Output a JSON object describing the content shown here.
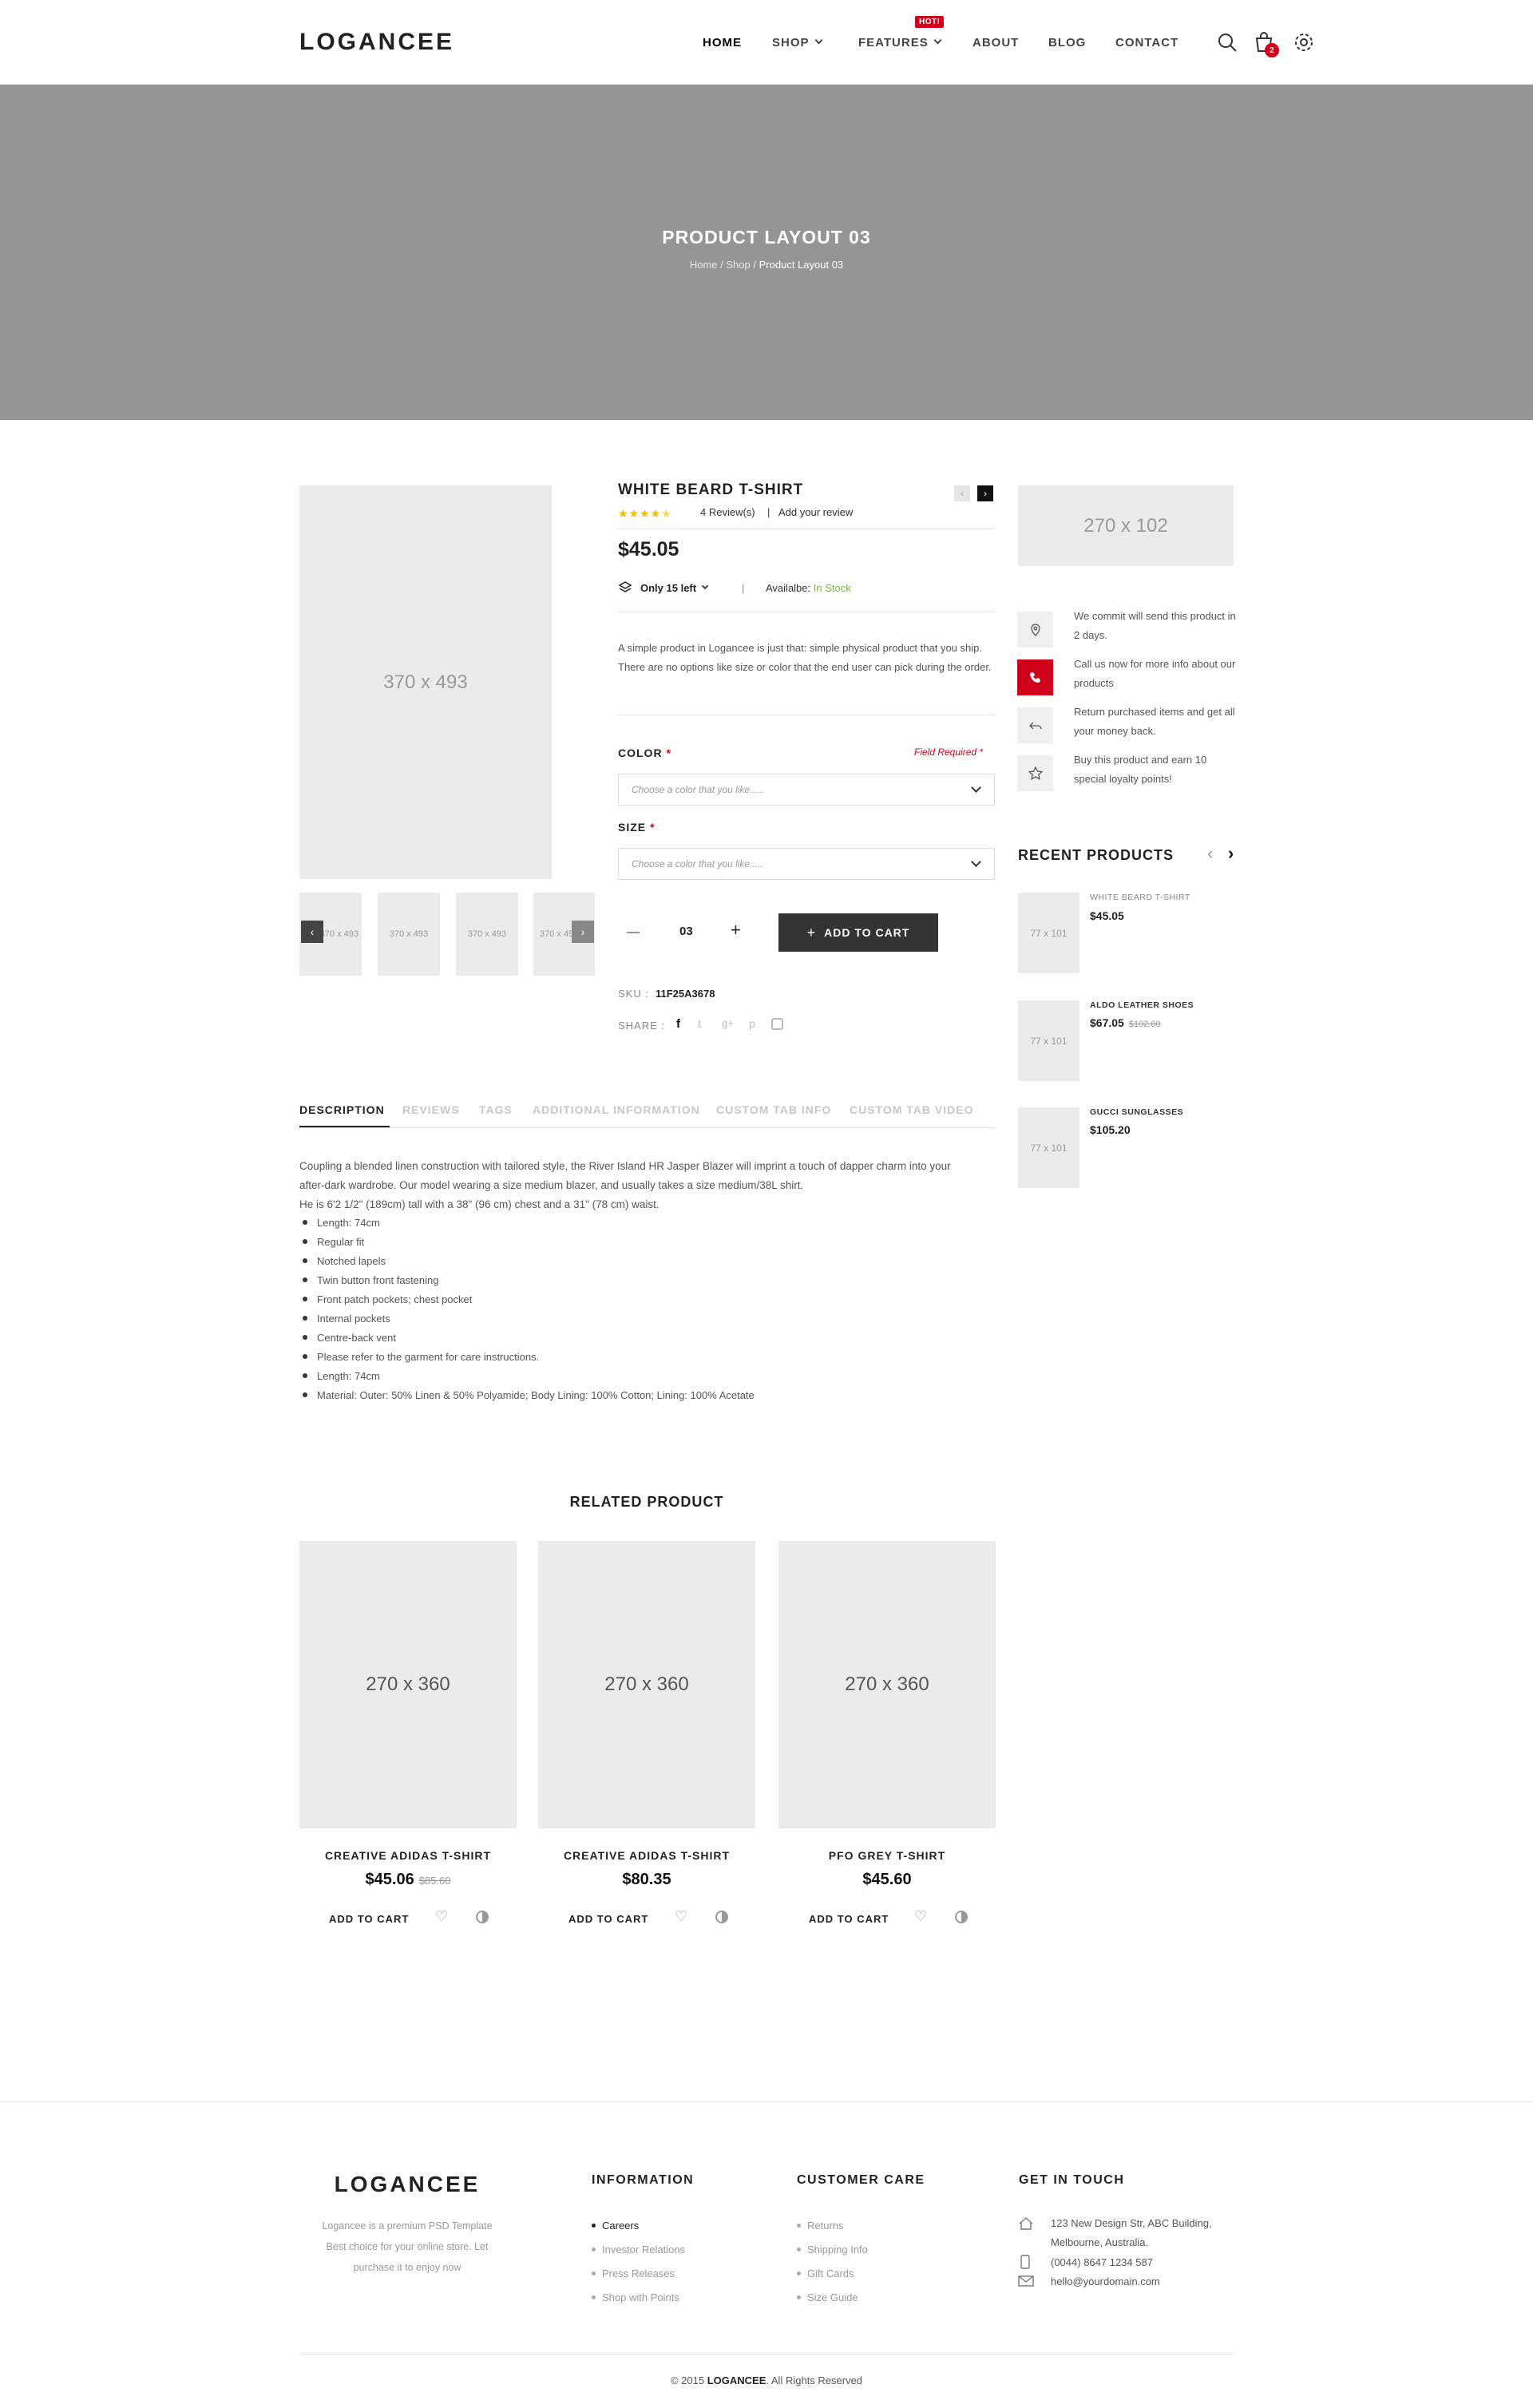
{
  "header": {
    "logo": "LOGANCEE",
    "nav": [
      "HOME",
      "SHOP",
      "FEATURES",
      "ABOUT",
      "BLOG",
      "CONTACT"
    ],
    "hot_badge": "HOT!",
    "cart_count": "2"
  },
  "banner": {
    "title": "PRODUCT LAYOUT 03",
    "crumb_home": "Home",
    "crumb_shop": "Shop",
    "crumb_current": "Product Layout 03",
    "sep": "/"
  },
  "gallery": {
    "main": "370 x 493",
    "thumbs": [
      "370 x 493",
      "370 x 493",
      "370 x 493",
      "370 x 493"
    ]
  },
  "product": {
    "title": "WHITE BEARD T-SHIRT",
    "reviews": "4 Review(s)",
    "review_sep": "|",
    "add_review": "Add your review",
    "price": "$45.05",
    "stock_count": "Only 15 left",
    "avail_sep": "|",
    "avail_label": "Availalbe:",
    "avail_value": "In Stock",
    "description": "A simple product in Logancee is just that: simple physical product that you ship. There are no options like size or color that the end user can pick during the order.",
    "color_label": "COLOR",
    "required_mark": "*",
    "field_required": "Field Required *",
    "color_placeholder": "Choose a color that you like.....",
    "size_label": "SIZE",
    "size_placeholder": "Choose a color that you like.....",
    "qty": "03",
    "add_to_cart": "ADD TO CART",
    "sku_label": "SKU :",
    "sku": "11F25A3678",
    "share_label": "SHARE :",
    "accent": "#d0021b",
    "stock_color": "#7cb342"
  },
  "tabs": [
    "DESCRIPTION",
    "REVIEWS",
    "TAGS",
    "ADDITIONAL INFORMATION",
    "CUSTOM TAB INFO",
    "CUSTOM TAB VIDEO"
  ],
  "details": {
    "para1": "Coupling a blended linen construction with tailored style, the River Island HR Jasper Blazer will imprint a touch of dapper charm into your after-dark wardrobe. Our model wearing a size medium blazer, and usually takes a size medium/38L shirt.",
    "para2": "He is 6'2 1/2\" (189cm) tall with a 38\" (96 cm) chest and a 31\" (78 cm) waist.",
    "bullets": [
      "Length: 74cm",
      "Regular fit",
      "Notched lapels",
      "Twin button front fastening",
      "Front patch pockets; chest pocket",
      "Internal pockets",
      "Centre-back vent",
      "Please refer to the garment for care instructions.",
      "Length: 74cm",
      "Material: Outer: 50% Linen & 50% Polyamide; Body Lining: 100% Cotton; Lining: 100% Acetate"
    ]
  },
  "sidebar": {
    "banner": "270 x 102",
    "services": [
      "We commit will send this product in 2 days.",
      "Call us now for more info about our products",
      "Return purchased items and get all your money back.",
      "Buy this product and earn 10 special loyalty points!"
    ],
    "recent_title": "RECENT PRODUCTS",
    "recent": [
      {
        "img": "77 x 101",
        "name": "WHITE BEARD T-SHIRT",
        "price": "$45.05",
        "old": ""
      },
      {
        "img": "77 x 101",
        "name": "ALDO LEATHER SHOES",
        "price": "$67.05",
        "old": "$102.00"
      },
      {
        "img": "77 x 101",
        "name": "GUCCI SUNGLASSES",
        "price": "$105.20",
        "old": ""
      }
    ]
  },
  "related": {
    "title": "RELATED PRODUCT",
    "items": [
      {
        "img": "270 x 360",
        "name": "CREATIVE ADIDAS T-SHIRT",
        "price": "$45.06",
        "old": "$85.60",
        "add": "ADD TO CART"
      },
      {
        "img": "270 x 360",
        "name": "CREATIVE ADIDAS T-SHIRT",
        "price": "$80.35",
        "old": "",
        "add": "ADD TO CART"
      },
      {
        "img": "270 x 360",
        "name": "PFO GREY T-SHIRT",
        "price": "$45.60",
        "old": "",
        "add": "ADD TO CART"
      }
    ]
  },
  "footer": {
    "logo": "LOGANCEE",
    "about": "Logancee is a premium PSD Template Best choice for your online store. Let purchase it to enjoy now",
    "info_title": "INFORMATION",
    "info_links": [
      "Careers",
      "Investor Relations",
      "Press Releases",
      "Shop with Points"
    ],
    "care_title": "CUSTOMER CARE",
    "care_links": [
      "Returns",
      "Shipping Info",
      "Gift Cards",
      "Size Guide"
    ],
    "touch_title": "GET IN TOUCH",
    "address": "123 New Design Str, ABC Building, Melbourne, Australia.",
    "phone": "(0044) 8647 1234 587",
    "email": "hello@yourdomain.com",
    "copyright_pre": "© 2015",
    "copyright_brand": "LOGANCEE",
    "copyright_post": ". All Rights Reserved"
  }
}
